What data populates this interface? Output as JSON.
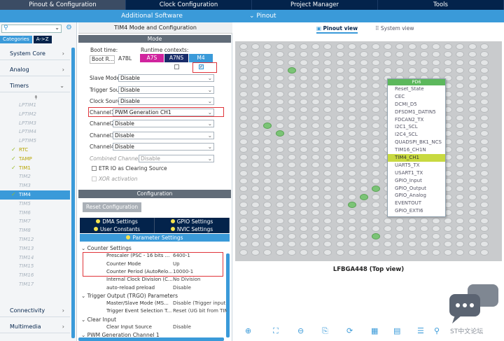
{
  "top_tabs": [
    "Pinout & Configuration",
    "Clock Configuration",
    "Project Manager",
    "Tools"
  ],
  "subbar": {
    "additional": "Additional Software",
    "pinout": "Pinout"
  },
  "left": {
    "search_placeholder": "",
    "tab_categories": "Categories",
    "tab_az": "A->Z",
    "categories": [
      "System Core",
      "Analog",
      "Timers",
      "Connectivity",
      "Multimedia"
    ],
    "timers": [
      {
        "label": "LPTIM1",
        "state": "disabled"
      },
      {
        "label": "LPTIM2",
        "state": "disabled"
      },
      {
        "label": "LPTIM3",
        "state": "disabled"
      },
      {
        "label": "LPTIM4",
        "state": "disabled"
      },
      {
        "label": "LPTIM5",
        "state": "disabled"
      },
      {
        "label": "RTC",
        "state": "enabled"
      },
      {
        "label": "TAMP",
        "state": "enabled"
      },
      {
        "label": "TIM1",
        "state": "enabled"
      },
      {
        "label": "TIM2",
        "state": "disabled"
      },
      {
        "label": "TIM3",
        "state": "disabled"
      },
      {
        "label": "TIM4",
        "state": "selected"
      },
      {
        "label": "TIM5",
        "state": "disabled"
      },
      {
        "label": "TIM6",
        "state": "disabled"
      },
      {
        "label": "TIM7",
        "state": "disabled"
      },
      {
        "label": "TIM8",
        "state": "disabled"
      },
      {
        "label": "TIM12",
        "state": "disabled"
      },
      {
        "label": "TIM13",
        "state": "disabled"
      },
      {
        "label": "TIM14",
        "state": "disabled"
      },
      {
        "label": "TIM15",
        "state": "disabled"
      },
      {
        "label": "TIM16",
        "state": "disabled"
      },
      {
        "label": "TIM17",
        "state": "disabled"
      }
    ]
  },
  "mid": {
    "title": "TIM4 Mode and Configuration",
    "mode_band": "Mode",
    "boot_time": "Boot time:",
    "runtime_contexts": "Runtime contexts:",
    "boot_r": "Boot R...",
    "a7bl": "A7BL",
    "ctx_a7s": "A7S",
    "ctx_a7ns": "A7NS",
    "ctx_m4": "M4",
    "fields": [
      {
        "label": "Slave Mode",
        "value": "Disable"
      },
      {
        "label": "Trigger Source",
        "value": "Disable"
      },
      {
        "label": "Clock Source",
        "value": "Disable"
      },
      {
        "label": "Channel1",
        "value": "PWM Generation CH1"
      },
      {
        "label": "Channel2",
        "value": "Disable"
      },
      {
        "label": "Channel3",
        "value": "Disable"
      },
      {
        "label": "Channel4",
        "value": "Disable"
      },
      {
        "label": "Combined Channels",
        "value": "Disable"
      }
    ],
    "etr_label": "ETR IO as Clearing Source",
    "xor_label": "XOR activation",
    "config_band": "Configuration",
    "reset_btn": "Reset Configuration",
    "settings": [
      [
        "DMA Settings",
        "GPIO Settings"
      ],
      [
        "User Constants",
        "NVIC Settings"
      ]
    ],
    "param_tab": "Parameter Settings",
    "params": [
      {
        "k": "Counter Settings",
        "v": "",
        "group": true
      },
      {
        "k": "Prescaler (PSC - 16 bits ...",
        "v": "6400-1"
      },
      {
        "k": "Counter Mode",
        "v": "Up"
      },
      {
        "k": "Counter Period (AutoRelo...",
        "v": "10000-1"
      },
      {
        "k": "Internal Clock Division (C...",
        "v": "No Division"
      },
      {
        "k": "auto-reload preload",
        "v": "Disable"
      },
      {
        "k": "Trigger Output (TRGO) Parameters",
        "v": "",
        "group": true
      },
      {
        "k": "Master/Slave Mode (MS...",
        "v": "Disable (Trigger input e"
      },
      {
        "k": "Trigger Event Selection T...",
        "v": "Reset (UG bit from TIM"
      },
      {
        "k": "Clear Input",
        "v": "",
        "group": true
      },
      {
        "k": "Clear Input Source",
        "v": "Disable"
      },
      {
        "k": "PWM Generation Channel 1",
        "v": "",
        "group": true
      }
    ]
  },
  "right": {
    "tab_pinout": "Pinout view",
    "tab_system": "System view",
    "popup_header": "PD6",
    "popup_items": [
      "Reset_State",
      "CEC",
      "DCMI_D5",
      "DFSDM1_DATIN5",
      "FDCAN2_TX",
      "I2C1_SCL",
      "I2C4_SCL",
      "QUADSPI_BK1_NCS",
      "TIM16_CH1N",
      "TIM4_CH1",
      "UART5_TX",
      "USART1_TX",
      "GPIO_Input",
      "GPIO_Output",
      "GPIO_Analog",
      "EVENTOUT",
      "GPIO_EXTI6"
    ],
    "popup_selected": "TIM4_CH1",
    "caption": "LFBGA448 (Top view)",
    "watermark": "ST中文论坛"
  },
  "colors": {
    "navy": "#03234b",
    "accent": "#3a9ad9",
    "pin_green": "#7bc476",
    "highlight": "#c8d940",
    "annot_red": "#e0353b"
  }
}
